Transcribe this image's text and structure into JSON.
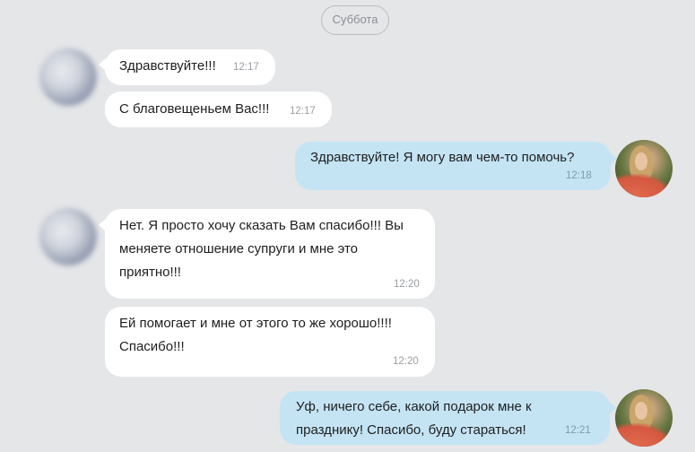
{
  "day_divider": "Суббота",
  "messages": [
    {
      "direction": "in",
      "text": "Здравствуйте!!!",
      "time": "12:17"
    },
    {
      "direction": "in",
      "text": "С благовещеньем Вас!!!",
      "time": "12:17"
    },
    {
      "direction": "out",
      "text": "Здравствуйте! Я могу вам чем-то помочь?",
      "time": "12:18"
    },
    {
      "direction": "in",
      "text": "Нет. Я просто хочу сказать Вам спасибо!!! Вы меняете отношение супруги и мне это приятно!!!",
      "time": "12:20"
    },
    {
      "direction": "in",
      "text": "Ей помогает и мне от этого то же хорошо!!!! Спасибо!!!",
      "time": "12:20"
    },
    {
      "direction": "out",
      "text": "Уф, ничего себе, какой подарок мне к празднику! Спасибо, буду стараться!",
      "time": "12:21"
    }
  ],
  "colors": {
    "background": "#e4e6e8",
    "incoming": "#ffffff",
    "outgoing": "#c4e4f4"
  }
}
